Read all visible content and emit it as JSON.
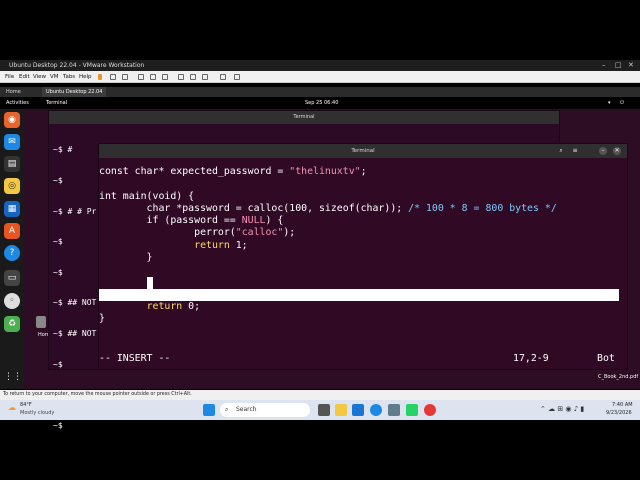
{
  "vmware": {
    "title": "Ubuntu Desktop 22.04 - VMware Workstation",
    "menu": [
      "File",
      "Edit",
      "View",
      "VM",
      "Tabs",
      "Help"
    ],
    "tabs": [
      {
        "label": "Home"
      },
      {
        "label": "Ubuntu Desktop 22.04"
      }
    ],
    "status_text": "To return to your computer, move the mouse pointer outside or press Ctrl+Alt."
  },
  "ubuntu": {
    "activities": "Activities",
    "app": "Terminal",
    "clock": "Sep 25  06:40"
  },
  "term_back": {
    "title": "Terminal",
    "lines": [
      "~$ #             WARNING!!!",
      "~$",
      "~$ # # Pr",
      "~$",
      "~$",
      "~$ ## NOT",
      "~$ ## NOT",
      "~$",
      "~$",
      "~$ "
    ]
  },
  "term_front": {
    "title": "Terminal",
    "line1_a": "const char* expected_password = ",
    "line1_b": "\"thelinuxtv\"",
    "line1_c": ";",
    "line3": "int main(void) {",
    "line4_a": "        char *password = calloc(100, sizeof(char)); ",
    "line4_b": "/* 100 * 8 = 800 bytes */",
    "line5_a": "        if (password == ",
    "line5_b": "NULL",
    "line5_c": ") {",
    "line6_a": "                perror(",
    "line6_b": "\"calloc\"",
    "line6_c": ");",
    "line7_a": "                ",
    "line7_b": "return",
    "line7_c": " 1;",
    "line8": "        }",
    "line11_a": "        ",
    "line11_b": "return",
    "line11_c": " 0;",
    "line12": "}",
    "mode": "-- INSERT --",
    "position": "17,2-9",
    "scroll": "Bot"
  },
  "desktop": {
    "file_label": "C_Book_2nd.pdf",
    "home_label": "Hom"
  },
  "taskbar": {
    "weather_temp": "84°F",
    "weather_desc": "Mostly cloudy",
    "search": "Search",
    "time": "7:40 AM",
    "date": "9/23/2026"
  }
}
